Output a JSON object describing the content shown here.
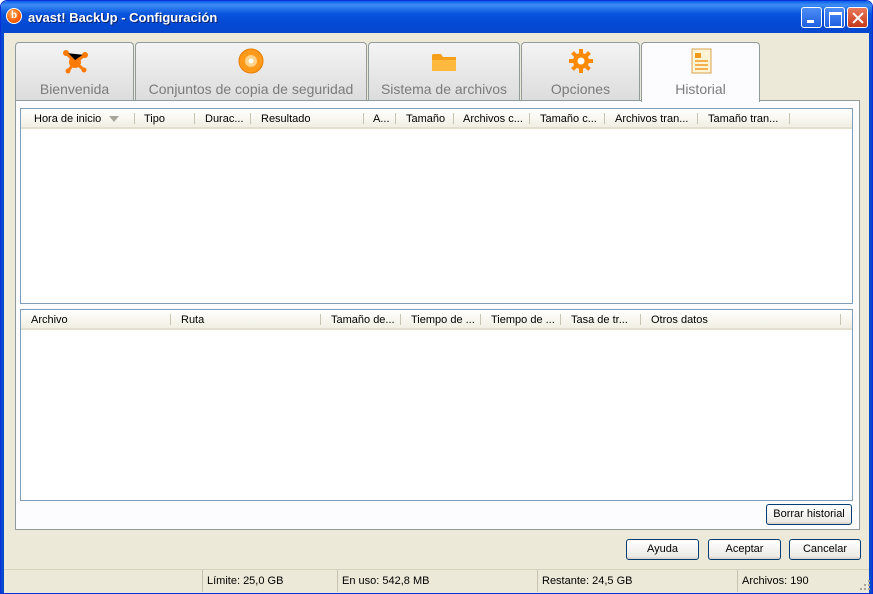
{
  "window": {
    "title": "avast! BackUp - Configuración",
    "icon": "avast-b-icon",
    "accent": "#0648ce"
  },
  "tabs": [
    {
      "label": "Bienvenida",
      "icon": "avast-splash-icon",
      "active": false
    },
    {
      "label": "Conjuntos de copia de seguridad",
      "icon": "disc-icon",
      "active": false
    },
    {
      "label": "Sistema de archivos",
      "icon": "folder-icon",
      "active": false
    },
    {
      "label": "Opciones",
      "icon": "gear-icon",
      "active": false
    },
    {
      "label": "Historial",
      "icon": "history-list-icon",
      "active": true
    }
  ],
  "history_table": {
    "columns": [
      "Hora de inicio",
      "Tipo",
      "Durac...",
      "Resultado",
      "A...",
      "Tamaño",
      "Archivos c...",
      "Tamaño c...",
      "Archivos tran...",
      "Tamaño tran..."
    ],
    "sorted_column": "Hora de inicio",
    "rows": []
  },
  "files_table": {
    "columns": [
      "Archivo",
      "Ruta",
      "Tamaño de...",
      "Tiempo de ...",
      "Tiempo de ...",
      "Tasa de tr...",
      "Otros datos"
    ],
    "rows": []
  },
  "buttons": {
    "clear_history": "Borrar historial",
    "help": "Ayuda",
    "accept": "Aceptar",
    "cancel": "Cancelar"
  },
  "status": {
    "limit": "Límite: 25,0 GB",
    "in_use": "En uso: 542,8 MB",
    "remaining": "Restante: 24,5 GB",
    "files": "Archivos: 190"
  }
}
